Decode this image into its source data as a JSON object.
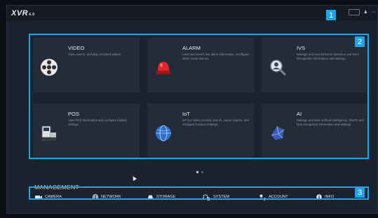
{
  "app": {
    "logo": "XVR",
    "version": "4.0"
  },
  "callouts": [
    "1",
    "2",
    "3"
  ],
  "cards": [
    {
      "title": "VIDEO",
      "desc": "View, search, and play recorded videos.",
      "icon": "film-reel-icon"
    },
    {
      "title": "ALARM",
      "desc": "View and search live alarm information. Configure alarm event actions.",
      "icon": "alarm-light-icon"
    },
    {
      "title": "IVS",
      "desc": "Manage and view behavior detection and Face Recognition information and settings.",
      "icon": "ivs-person-icon"
    },
    {
      "title": "POS",
      "desc": "View POS information and configure related settings.",
      "icon": "pos-terminal-icon"
    },
    {
      "title": "IoT",
      "desc": "IoT live video preview, search, export reports, and configure function settings.",
      "icon": "globe-icon"
    },
    {
      "title": "AI",
      "desc": "Manage and view artificial intelligence, IDVFR and face recognition information and settings.",
      "icon": "ai-brain-icon"
    }
  ],
  "pager": {
    "pages": 2,
    "current": 1
  },
  "management": {
    "title": "MANAGEMENT",
    "items": [
      {
        "label": "CAMERA",
        "icon": "camera-icon"
      },
      {
        "label": "NETWORK",
        "icon": "network-icon"
      },
      {
        "label": "STORAGE",
        "icon": "storage-icon"
      },
      {
        "label": "SYSTEM",
        "icon": "system-gear-icon"
      },
      {
        "label": "ACCOUNT",
        "icon": "account-icon"
      },
      {
        "label": "INFO",
        "icon": "info-icon"
      }
    ]
  },
  "colors": {
    "accent": "#1ea5e6",
    "background": "#1c2230",
    "card": "#252c39"
  }
}
